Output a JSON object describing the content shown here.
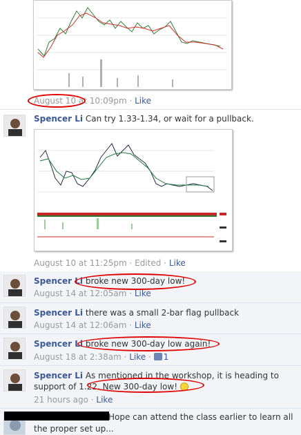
{
  "comments": [
    {
      "name": "",
      "text": "",
      "time": "August 10 at 10:09pm",
      "sep": " · ",
      "like": "Like"
    },
    {
      "name": "Spencer Li",
      "text": " Can try 1.33-1.34, or wait for a pullback.",
      "time": "August 10 at 11:25pm",
      "edited": "Edited",
      "sep": " · ",
      "like": "Like"
    },
    {
      "name": "Spencer Li",
      "text": " broke new 300-day low!",
      "time": "August 14 at 12:05am",
      "sep": " · ",
      "like": "Like"
    },
    {
      "name": "Spencer Li",
      "text": " there was a small 2-bar flag pullback",
      "time": "August 14 at 12:06am",
      "sep": " · ",
      "like": "Like"
    },
    {
      "name": "Spencer Li",
      "text": " broke new 300-day low again!",
      "time": "August 18 at 2:38am",
      "sep": " · ",
      "like": "Like",
      "like_count": "1"
    },
    {
      "name": "Spencer Li",
      "text_line1": " As mentioned in the workshop, it is heading to",
      "text_line2": "support of 1.22. New 300-day low! ",
      "time": "21 hours ago",
      "sep": " · ",
      "like": "Like"
    },
    {
      "text_line1": "Hope can attend the class earlier to learn all",
      "text_line2": "the proper set up..."
    }
  ],
  "colors": {
    "link": "#3b5998",
    "highlight": "#e00000",
    "row_bg": "#f2f4f8"
  },
  "icons": [
    "avatar",
    "thumbs-up-icon",
    "smiley-icon"
  ]
}
